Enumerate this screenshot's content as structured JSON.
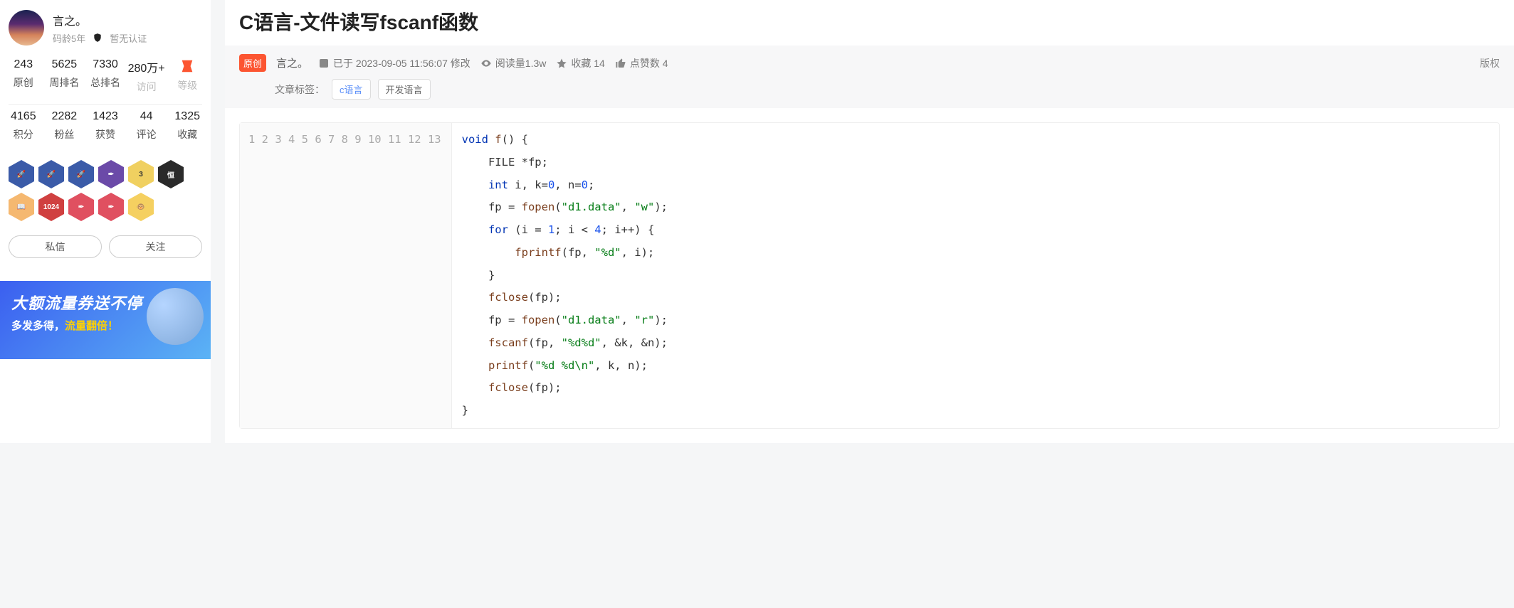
{
  "profile": {
    "name": "言之。",
    "age_label": "码龄5年",
    "cert_label": "暂无认证"
  },
  "stats_top": [
    {
      "num": "243",
      "label": "原创"
    },
    {
      "num": "5625",
      "label": "周排名"
    },
    {
      "num": "7330",
      "label": "总排名"
    },
    {
      "num": "280万+",
      "label": "访问"
    },
    {
      "num": "",
      "label": "等级"
    }
  ],
  "stats_bottom": [
    {
      "num": "4165",
      "label": "积分"
    },
    {
      "num": "2282",
      "label": "粉丝"
    },
    {
      "num": "1423",
      "label": "获赞"
    },
    {
      "num": "44",
      "label": "评论"
    },
    {
      "num": "1325",
      "label": "收藏"
    }
  ],
  "buttons": {
    "dm": "私信",
    "follow": "关注"
  },
  "promo": {
    "title": "大额流量券送不停",
    "sub1": "多发多得，",
    "sub2": "流量翻倍！"
  },
  "article": {
    "title": "C语言-文件读写fscanf函数",
    "orig_badge": "原创",
    "author": "言之。",
    "timestamp": "已于 2023-09-05 11:56:07 修改",
    "views_label": "阅读量1.3w",
    "collect_label": "收藏 14",
    "likes_label": "点赞数 4",
    "copyright": "版权",
    "tags_label": "文章标签：",
    "tags": [
      "c语言",
      "开发语言"
    ]
  },
  "code": {
    "lines": 13
  }
}
